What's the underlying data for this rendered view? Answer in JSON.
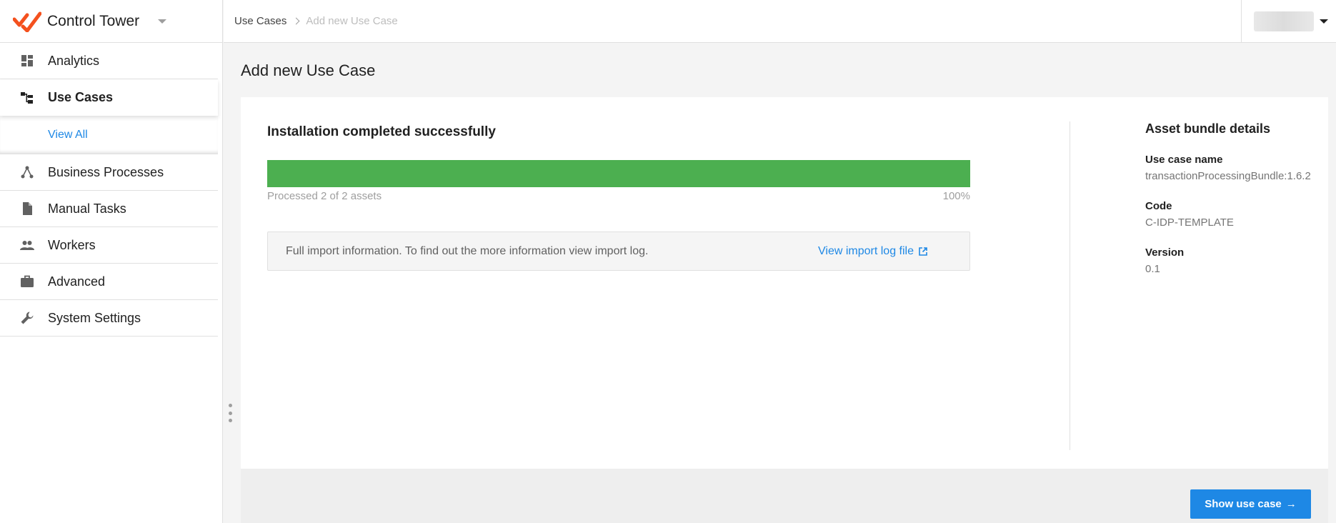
{
  "brand": {
    "name": "Control Tower",
    "logo_color": "#f4511e"
  },
  "sidebar": {
    "items": [
      {
        "label": "Analytics",
        "icon": "dashboard-icon"
      },
      {
        "label": "Use Cases",
        "icon": "hierarchy-icon",
        "active": true
      },
      {
        "label": "Business Processes",
        "icon": "process-icon"
      },
      {
        "label": "Manual Tasks",
        "icon": "document-icon"
      },
      {
        "label": "Workers",
        "icon": "people-icon"
      },
      {
        "label": "Advanced",
        "icon": "briefcase-icon"
      },
      {
        "label": "System Settings",
        "icon": "wrench-icon"
      }
    ],
    "subitem": {
      "label": "View All"
    }
  },
  "breadcrumb": {
    "parent": "Use Cases",
    "current": "Add new Use Case"
  },
  "page": {
    "title": "Add new Use Case"
  },
  "install": {
    "title": "Installation completed successfully",
    "progress_percent": 100,
    "progress_label": "Processed 2 of 2 assets",
    "progress_pct_text": "100%",
    "progress_color": "#4caf50",
    "info_text": "Full import information. To find out the more information view import log.",
    "log_link": "View import log file"
  },
  "details": {
    "title": "Asset bundle details",
    "use_case_name_label": "Use case name",
    "use_case_name": "transactionProcessingBundle:1.6.2",
    "code_label": "Code",
    "code": "C-IDP-TEMPLATE",
    "version_label": "Version",
    "version": "0.1"
  },
  "footer": {
    "show_button": "Show use case",
    "accent": "#1e88e5"
  }
}
